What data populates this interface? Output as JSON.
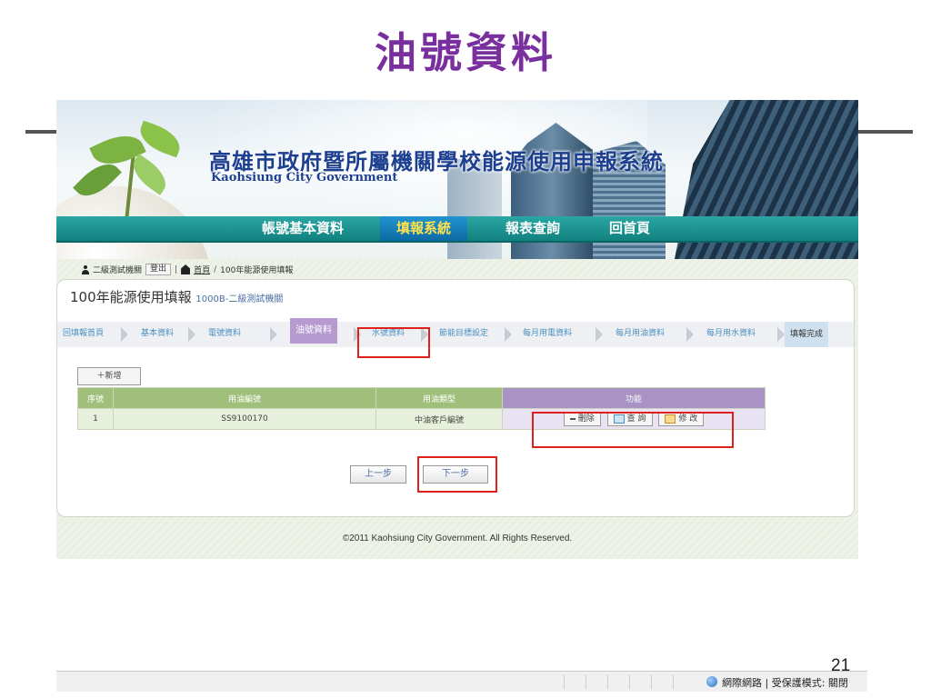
{
  "slide": {
    "title": "油號資料",
    "page_number": "21"
  },
  "banner": {
    "title": "高雄市政府暨所屬機關學校能源使用申報系統",
    "subtitle": "Kaohsiung City Government"
  },
  "topnav": {
    "items": [
      {
        "label": "帳號基本資料",
        "active": false
      },
      {
        "label": "填報系統",
        "active": true
      },
      {
        "label": "報表查詢",
        "active": false
      },
      {
        "label": "回首頁",
        "active": false
      }
    ]
  },
  "crumb": {
    "user": "二級測試機關",
    "logout": "登出",
    "home": "首頁",
    "path": "100年能源使用填報"
  },
  "panel": {
    "title": "100年能源使用填報",
    "org": "1000B-二級測試機關"
  },
  "steps": [
    "回填報首頁",
    "基本資料",
    "電號資料",
    "油號資料",
    "水號資料",
    "節能目標設定",
    "每月用電資料",
    "每月用油資料",
    "每月用水資料",
    "填報完成"
  ],
  "add_button": "＋新增",
  "table": {
    "headers": [
      "序號",
      "用油編號",
      "用油類型",
      "功能"
    ],
    "rows": [
      {
        "seq": "1",
        "code": "SS9100170",
        "type": "中油客戶編號"
      }
    ],
    "actions": {
      "delete": "刪除",
      "query": "查 詢",
      "edit": "修 改"
    }
  },
  "nav_buttons": {
    "prev": "上一步",
    "next": "下一步"
  },
  "footer": "©2011 Kaohsiung City Government. All Rights Reserved.",
  "statusbar": {
    "text": "網際網路 | 受保護模式: 關閉"
  },
  "colors": {
    "slide_title": "#7a2f9e",
    "nav_teal": "#11817f",
    "active_step": "#b79bd0",
    "highlight": "#e0201a"
  }
}
